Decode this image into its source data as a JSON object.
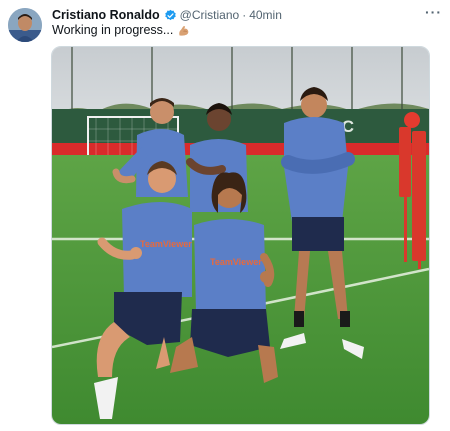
{
  "tweet": {
    "author_name": "Cristiano Ronaldo",
    "author_handle": "@Cristiano",
    "separator": "·",
    "timestamp": "40min",
    "text": "Working in progress...",
    "more_label": "···",
    "verified_color": "#1d9bf0"
  },
  "photo": {
    "banner_text": "IN C",
    "shirt_sponsor": "TeamViewer"
  },
  "colors": {
    "accent": "#1d9bf0",
    "secondary_text": "#536471",
    "kit_shirt": "#5b7fc7",
    "kit_shorts": "#1f2b4d",
    "grass": "#4e9a3a"
  }
}
